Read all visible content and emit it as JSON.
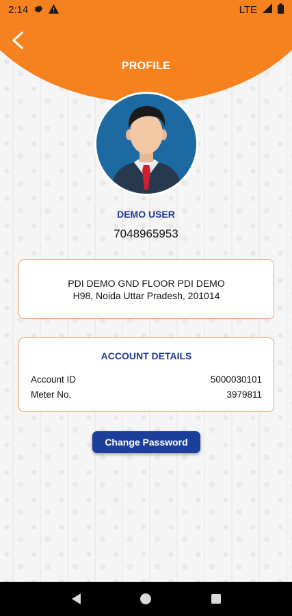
{
  "status_bar": {
    "time": "2:14",
    "network": "LTE",
    "icons": [
      "gear-icon",
      "warning-icon",
      "signal-icon",
      "battery-icon"
    ]
  },
  "header": {
    "title": "PROFILE",
    "back_icon": "back-arrow-icon"
  },
  "user": {
    "name": "DEMO USER",
    "phone": "7048965953"
  },
  "address": {
    "line1": "PDI DEMO GND FLOOR PDI DEMO",
    "line2": "H98, Noida Uttar Pradesh, 201014"
  },
  "account": {
    "title": "ACCOUNT DETAILS",
    "rows": [
      {
        "label": "Account ID",
        "value": "5000030101"
      },
      {
        "label": "Meter No.",
        "value": "3979811"
      }
    ]
  },
  "actions": {
    "change_password": "Change Password"
  },
  "colors": {
    "accent": "#f5821f",
    "primary": "#1b3f9a",
    "card_border": "#f0a46a"
  }
}
